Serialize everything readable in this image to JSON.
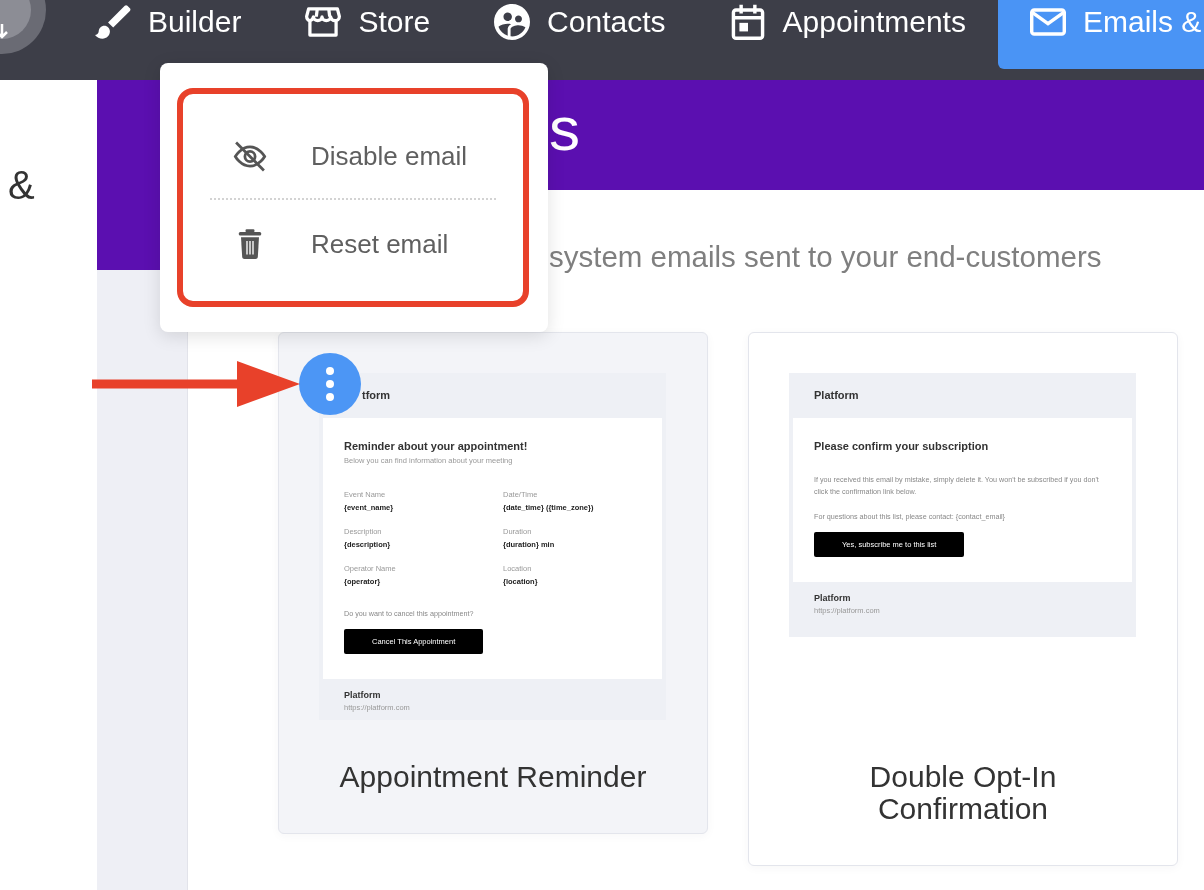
{
  "top_nav": {
    "items": [
      {
        "label": "Builder",
        "selected": false
      },
      {
        "label": "Store",
        "selected": false
      },
      {
        "label": "Contacts",
        "selected": false
      },
      {
        "label": "Appointments",
        "selected": false
      },
      {
        "label": "Emails &",
        "selected": true
      }
    ]
  },
  "sidebar": {
    "title": "&"
  },
  "header": {
    "title": "s",
    "subtitle": "system emails sent to your end-customers"
  },
  "email_cards": [
    {
      "title": "Appointment Reminder",
      "hovered": true,
      "preview": {
        "brand": "tform",
        "heading": "Reminder about your appointment!",
        "subheading": "Below you can find information about your meeting",
        "fields": [
          {
            "label": "Event Name",
            "value": "{event_name}"
          },
          {
            "label": "Date/Time",
            "value": "{date_time} ({time_zone})"
          },
          {
            "label": "Description",
            "value": "{description}"
          },
          {
            "label": "Duration",
            "value": "{duration} min"
          },
          {
            "label": "Operator Name",
            "value": "{operator}"
          },
          {
            "label": "Location",
            "value": "{location}"
          }
        ],
        "paragraphs": [
          "Do you want to cancel this appointment?"
        ],
        "button": "Cancel This Appointment",
        "footer": {
          "name": "Platform",
          "url": "https://platform.com"
        }
      }
    },
    {
      "title": "Double Opt-In Confirmation",
      "hovered": false,
      "preview": {
        "brand": "Platform",
        "heading": "Please confirm your subscription",
        "paragraphs": [
          "If you received this email by mistake, simply delete it. You won't be subscribed if you don't click the confirmation link below.",
          "For questions about this list, please contact: {contact_email}"
        ],
        "button": "Yes, subscribe me to this list",
        "footer": {
          "name": "Platform",
          "url": "https://platform.com"
        }
      }
    }
  ],
  "context_menu": {
    "items": [
      {
        "label": "Disable email"
      },
      {
        "label": "Reset email"
      }
    ]
  },
  "annotations": {
    "arrow": true,
    "highlight_frame": true
  }
}
